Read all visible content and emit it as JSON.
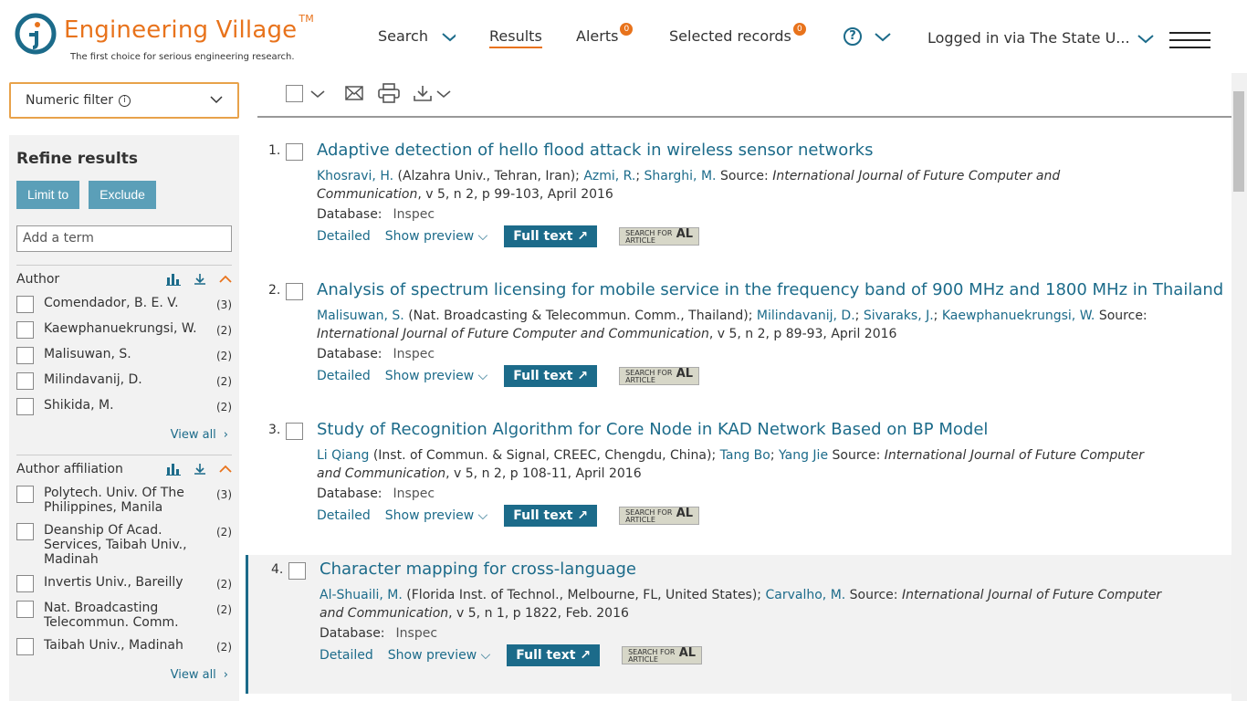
{
  "header": {
    "brand": "Engineering Village",
    "tm": "TM",
    "tagline": "The first choice for serious engineering research.",
    "nav": {
      "search": "Search",
      "results": "Results",
      "alerts": "Alerts",
      "alerts_count": "0",
      "selected": "Selected records",
      "selected_count": "0",
      "help": "?",
      "account": "Logged in via The State U..."
    },
    "colors": {
      "brand": "#e8731c",
      "link": "#1c6b8a",
      "button": "#5b9fb8"
    }
  },
  "sidebar": {
    "numeric_filter": "Numeric filter",
    "refine_title": "Refine results",
    "limit_to": "Limit to",
    "exclude": "Exclude",
    "add_term_placeholder": "Add a term",
    "author": {
      "title": "Author",
      "items": [
        {
          "label": "Comendador, B. E. V.",
          "count": "(3)"
        },
        {
          "label": "Kaewphanuekrungsi, W.",
          "count": "(2)"
        },
        {
          "label": "Malisuwan, S.",
          "count": "(2)"
        },
        {
          "label": "Milindavanij, D.",
          "count": "(2)"
        },
        {
          "label": "Shikida, M.",
          "count": "(2)"
        }
      ],
      "view_all": "View all"
    },
    "affiliation": {
      "title": "Author affiliation",
      "items": [
        {
          "label": "Polytech. Univ. Of The Philippines, Manila",
          "count": "(3)"
        },
        {
          "label": "Deanship Of Acad. Services, Taibah Univ., Madinah",
          "count": "(2)"
        },
        {
          "label": "Invertis Univ., Bareilly",
          "count": "(2)"
        },
        {
          "label": "Nat. Broadcasting Telecommun. Comm.",
          "count": "(2)"
        },
        {
          "label": "Taibah Univ., Madinah",
          "count": "(2)"
        }
      ],
      "view_all": "View all"
    }
  },
  "labels": {
    "source": "Source:",
    "database": "Database:",
    "detailed": "Detailed",
    "show_preview": "Show preview",
    "full_text": "Full text",
    "sfa_line1": "SEARCH FOR",
    "sfa_line2": "ARTICLE",
    "sfa_al": "AL"
  },
  "results": [
    {
      "num": "1.",
      "title": "Adaptive detection of hello flood attack in wireless sensor networks",
      "a1": "Khosravi, H.",
      "aff": " (Alzahra Univ., Tehran, Iran); ",
      "a2": "Azmi, R.",
      "a3": "Sharghi, M.",
      "journal": "International Journal of Future Computer and Communication",
      "details": ", v 5, n 2, p 99-103, April 2016",
      "database": "Inspec"
    },
    {
      "num": "2.",
      "title": "Analysis of spectrum licensing for mobile service in the frequency band of 900 MHz and 1800 MHz in Thailand",
      "a1": "Malisuwan, S.",
      "aff": " (Nat. Broadcasting & Telecommun. Comm., Thailand); ",
      "a2": "Milindavanij, D.",
      "a3": "Sivaraks, J.",
      "a4": "Kaewphanuekrungsi, W.",
      "journal": "International Journal of Future Computer and Communication",
      "details": ", v 5, n 2, p 89-93, April 2016",
      "database": "Inspec"
    },
    {
      "num": "3.",
      "title": "Study of Recognition Algorithm for Core Node in KAD Network Based on BP Model",
      "a1": "Li Qiang",
      "aff": " (Inst. of Commun. & Signal, CREEC, Chengdu, China); ",
      "a2": "Tang Bo",
      "a3": "Yang Jie",
      "journal": "International Journal of Future Computer and Communication",
      "details": ", v 5, n 2, p 108-11, April 2016",
      "database": "Inspec"
    },
    {
      "num": "4.",
      "title": "Character mapping for cross-language",
      "a1": "Al-Shuaili, M.",
      "aff": " (Florida Inst. of Technol., Melbourne, FL, United States); ",
      "a2": "Carvalho, M.",
      "journal": "International Journal of Future Computer and Communication",
      "details": ", v 5, n 1, p 1822, Feb. 2016",
      "database": "Inspec"
    }
  ]
}
